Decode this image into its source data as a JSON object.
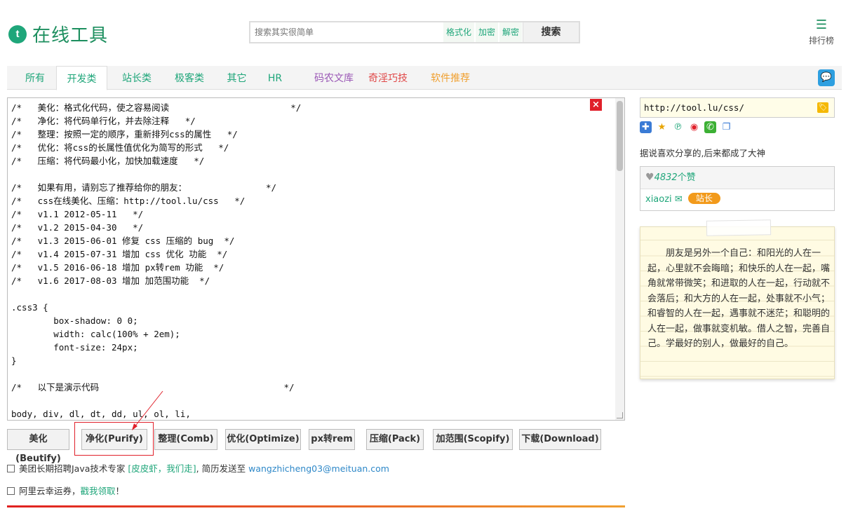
{
  "header": {
    "logo_letter": "t",
    "logo_text": "在线工具",
    "search_placeholder": "搜索其实很简单",
    "search_tags": [
      "格式化",
      "加密",
      "解密"
    ],
    "search_button": "搜索",
    "rank_label": "排行榜"
  },
  "nav": {
    "tabs": [
      {
        "label": "所有",
        "color": "#1fa67a"
      },
      {
        "label": "开发类",
        "color": "#1fa67a"
      },
      {
        "label": "站长类",
        "color": "#1fa67a"
      },
      {
        "label": "极客类",
        "color": "#1fa67a"
      },
      {
        "label": "其它",
        "color": "#1fa67a"
      },
      {
        "label": "HR",
        "color": "#1fa67a"
      },
      {
        "label": "码农文库",
        "color": "#9b59b6"
      },
      {
        "label": "奇淫巧技",
        "color": "#e04848"
      },
      {
        "label": "软件推荐",
        "color": "#f0a030"
      }
    ],
    "active_tab": "开发类"
  },
  "editor": {
    "content": "/*   美化：格式化代码，使之容易阅读                       */\n/*   净化：将代码单行化，并去除注释   */\n/*   整理：按照一定的顺序，重新排列css的属性   */\n/*   优化：将css的长属性值优化为简写的形式   */\n/*   压缩：将代码最小化，加快加载速度   */\n\n/*   如果有用，请别忘了推荐给你的朋友：               */\n/*   css在线美化、压缩：http://tool.lu/css   */\n/*   v1.1 2012-05-11   */\n/*   v1.2 2015-04-30   */\n/*   v1.3 2015-06-01 修复 css 压缩的 bug  */\n/*   v1.4 2015-07-31 增加 css 优化 功能  */\n/*   v1.5 2016-06-18 增加 px转rem 功能  */\n/*   v1.6 2017-08-03 增加 加范围功能  */\n\n.css3 {\n        box-shadow: 0 0;\n        width: calc(100% + 2em);\n        font-size: 24px;\n}\n\n/*   以下是演示代码                                   */\n\nbody, div, dl, dt, dd, ul, ol, li,"
  },
  "actions": [
    "美化(Beutify)",
    "净化(Purify)",
    "整理(Comb)",
    "优化(Optimize)",
    "px转rem",
    "压缩(Pack)",
    "加范围(Scopify)",
    "下载(Download)"
  ],
  "notices": {
    "job_prefix": "美团长期招聘Java技术专家",
    "job_link": "[皮皮虾，我们走]",
    "job_middle": ", 简历发送至",
    "job_email": "wangzhicheng03@meituan.com",
    "coupon_prefix": "阿里云幸运券，",
    "coupon_link": "戳我领取",
    "coupon_suffix": "！"
  },
  "sidebar": {
    "url": "http://tool.lu/css/",
    "slogan": "据说喜欢分享的,后来都成了大神",
    "likes_count": "4832",
    "likes_suffix": "个赞",
    "username": "xiaozi",
    "badge": "站长",
    "note_text": "朋友是另外一个自己：和阳光的人在一起，心里就不会晦暗；和快乐的人在一起，嘴角就常带微笑；和进取的人在一起，行动就不会落后；和大方的人在一起，处事就不小气；和睿智的人在一起，遇事就不迷茫；和聪明的人在一起，做事就变机敏。借人之智，完善自己。学最好的别人，做最好的自己。"
  }
}
